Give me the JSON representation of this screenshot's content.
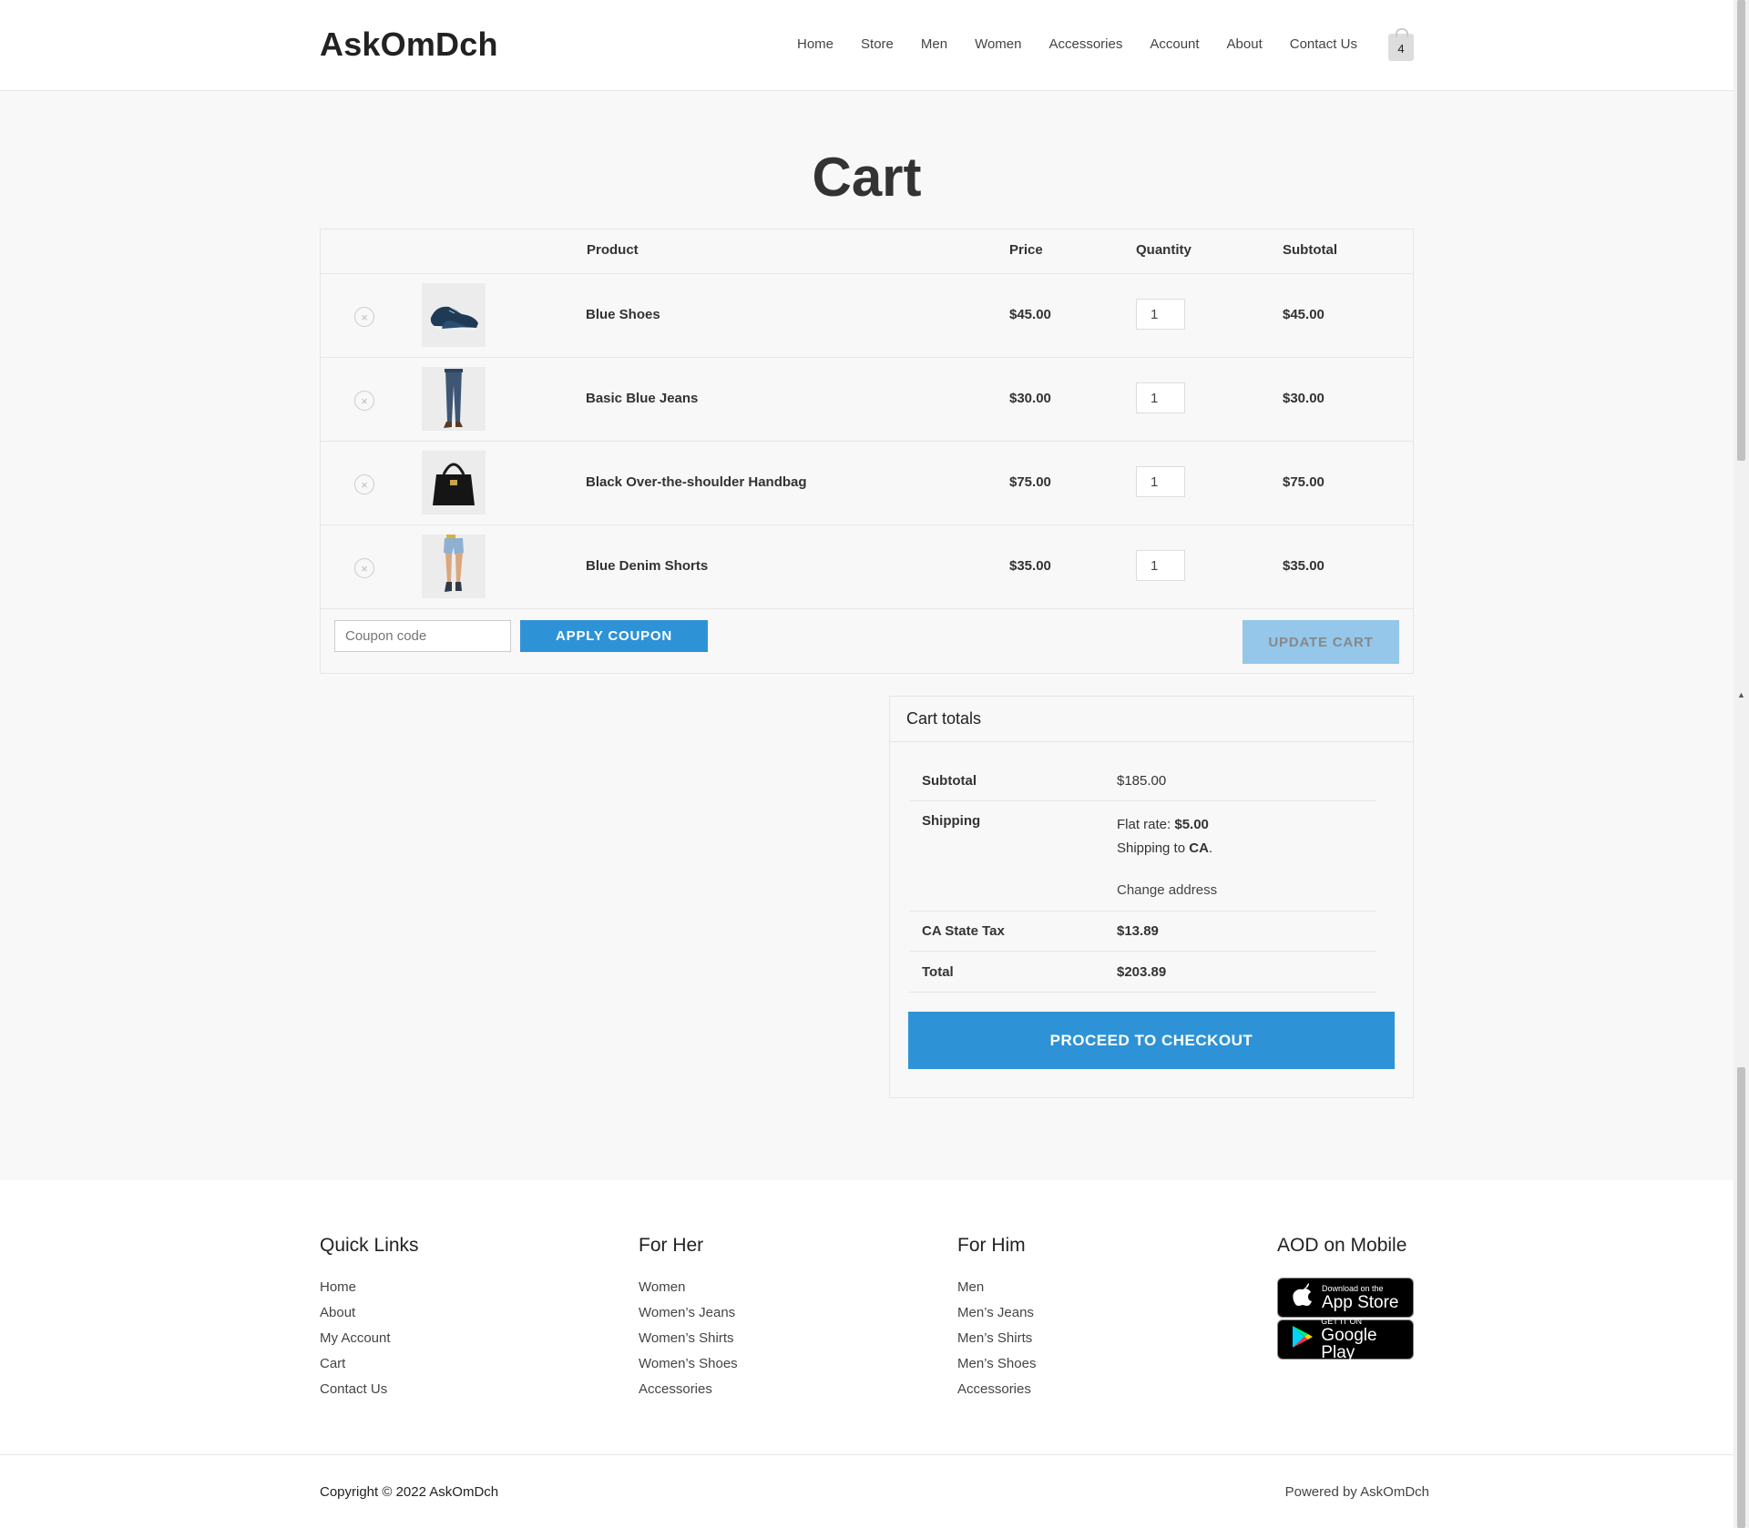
{
  "site": {
    "logo": "AskOmDch"
  },
  "nav": {
    "items": [
      "Home",
      "Store",
      "Men",
      "Women",
      "Accessories",
      "Account",
      "About",
      "Contact Us"
    ],
    "cart_count": "4"
  },
  "page_title": "Cart",
  "table": {
    "headers": {
      "product": "Product",
      "price": "Price",
      "quantity": "Quantity",
      "subtotal": "Subtotal"
    },
    "rows": [
      {
        "name": "Blue Shoes",
        "price": "$45.00",
        "qty": "1",
        "subtotal": "$45.00",
        "image": "shoes"
      },
      {
        "name": "Basic Blue Jeans",
        "price": "$30.00",
        "qty": "1",
        "subtotal": "$30.00",
        "image": "jeans"
      },
      {
        "name": "Black Over-the-shoulder Handbag",
        "price": "$75.00",
        "qty": "1",
        "subtotal": "$75.00",
        "image": "handbag"
      },
      {
        "name": "Blue Denim Shorts",
        "price": "$35.00",
        "qty": "1",
        "subtotal": "$35.00",
        "image": "shorts"
      }
    ],
    "remove_icon": "×"
  },
  "coupon": {
    "placeholder": "Coupon code",
    "apply_label": "APPLY COUPON",
    "update_label": "UPDATE CART"
  },
  "totals": {
    "title": "Cart totals",
    "subtotal_label": "Subtotal",
    "subtotal_value": "$185.00",
    "shipping_label": "Shipping",
    "shipping_rate_prefix": "Flat rate: ",
    "shipping_rate_value": "$5.00",
    "shipping_to_prefix": "Shipping to ",
    "shipping_to_value": "CA",
    "change_address": "Change address",
    "tax_label": "CA State Tax",
    "tax_value": "$13.89",
    "total_label": "Total",
    "total_value": "$203.89",
    "checkout_label": "PROCEED TO CHECKOUT"
  },
  "footer": {
    "quick_links": {
      "title": "Quick Links",
      "items": [
        "Home",
        "About",
        "My Account",
        "Cart",
        "Contact Us"
      ]
    },
    "for_her": {
      "title": "For Her",
      "items": [
        "Women",
        "Women’s Jeans",
        "Women’s Shirts",
        "Women’s Shoes",
        "Accessories"
      ]
    },
    "for_him": {
      "title": "For Him",
      "items": [
        "Men",
        "Men’s Jeans",
        "Men’s Shirts",
        "Men’s Shoes",
        "Accessories"
      ]
    },
    "mobile": {
      "title": "AOD on Mobile",
      "app_store_small": "Download on the",
      "app_store_big": "App Store",
      "google_small": "GET IT ON",
      "google_big": "Google Play"
    },
    "copyright": "Copyright © 2022 AskOmDch",
    "powered": "Powered by AskOmDch"
  },
  "colors": {
    "accent": "#2e93d6",
    "accent_disabled": "#94c7ea",
    "background": "#f8f8f8"
  }
}
